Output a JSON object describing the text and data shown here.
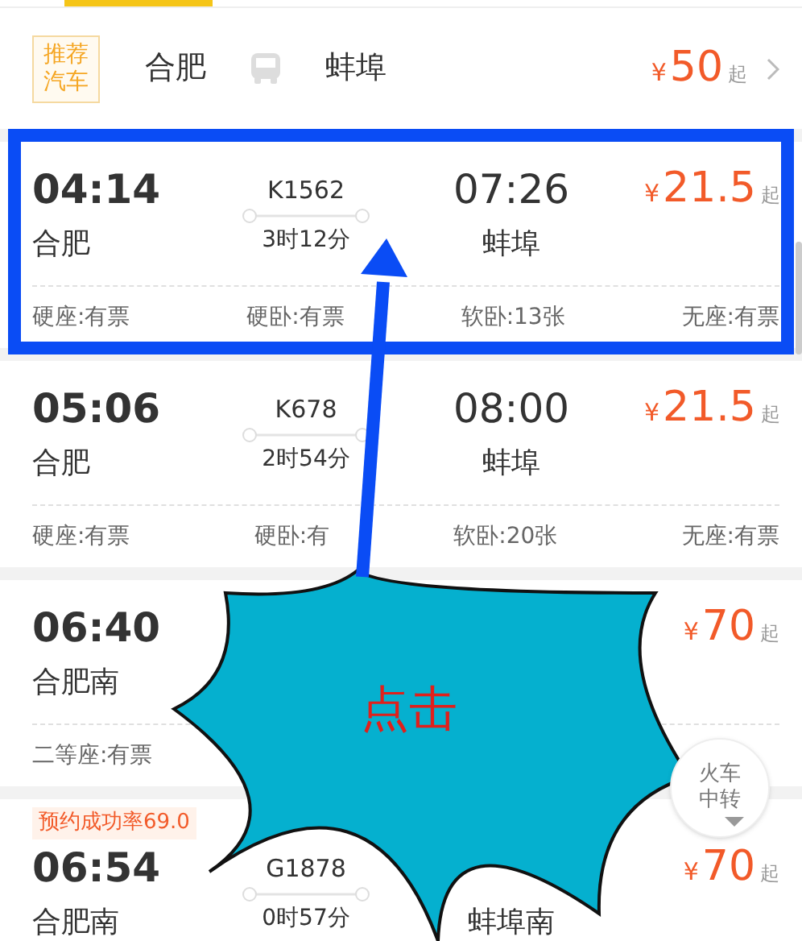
{
  "bus_recommendation": {
    "badge": "推荐汽车",
    "from": "合肥",
    "to": "蚌埠",
    "currency": "¥",
    "price": "50",
    "price_suffix": "起"
  },
  "trains": [
    {
      "depart_time": "04:14",
      "train_no": "K1562",
      "arrive_time": "07:26",
      "currency": "¥",
      "price": "21.5",
      "price_suffix": "起",
      "from": "合肥",
      "duration": "3时12分",
      "to": "蚌埠",
      "seats": [
        "硬座:有票",
        "硬卧:有票",
        "软卧:13张",
        "无座:有票"
      ]
    },
    {
      "depart_time": "05:06",
      "train_no": "K678",
      "arrive_time": "08:00",
      "currency": "¥",
      "price": "21.5",
      "price_suffix": "起",
      "from": "合肥",
      "duration": "2时54分",
      "to": "蚌埠",
      "seats": [
        "硬座:有票",
        "硬卧:有",
        "软卧:20张",
        "无座:有票"
      ]
    },
    {
      "depart_time": "06:40",
      "currency": "¥",
      "price": "70",
      "price_suffix": "起",
      "from": "合肥南",
      "seats": [
        "二等座:有票"
      ]
    },
    {
      "badge": "预约成功率69.0",
      "depart_time": "06:54",
      "train_no": "G1878",
      "currency": "¥",
      "price": "70",
      "price_suffix": "起",
      "from": "合肥南",
      "duration": "0时57分",
      "to": "蚌埠南"
    }
  ],
  "transfer_button": {
    "label": "火车中转"
  },
  "annotation": {
    "label": "点击"
  }
}
